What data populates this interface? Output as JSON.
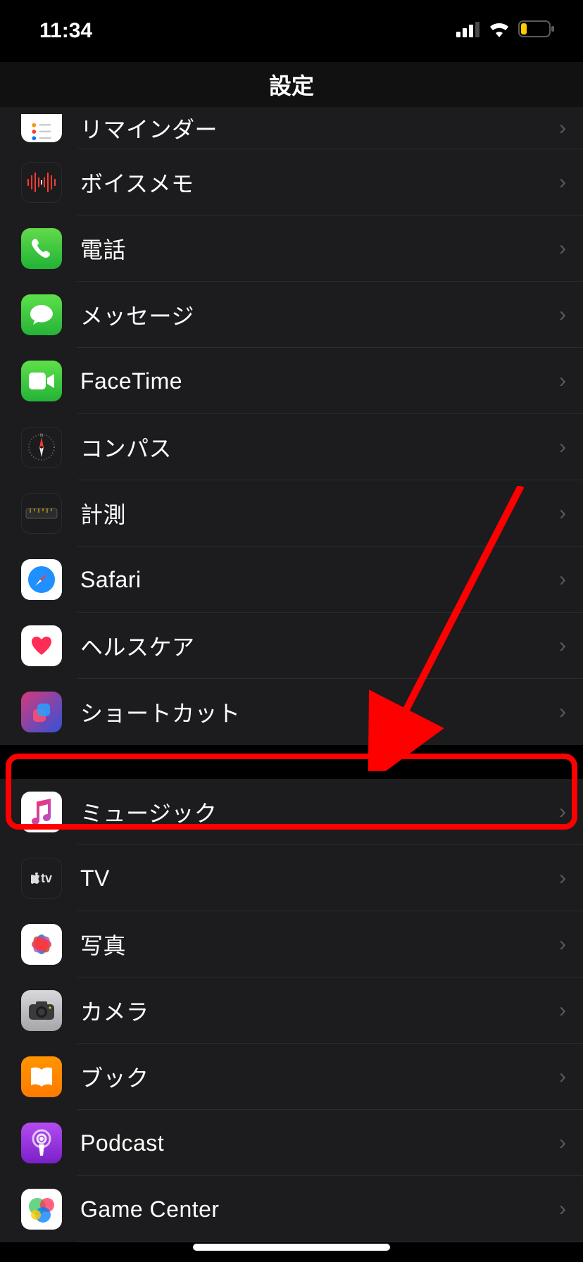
{
  "status": {
    "time": "11:34"
  },
  "nav": {
    "title": "設定"
  },
  "section1": [
    {
      "id": "reminders",
      "label": "リマインダー"
    },
    {
      "id": "voicememo",
      "label": "ボイスメモ"
    },
    {
      "id": "phone",
      "label": "電話"
    },
    {
      "id": "messages",
      "label": "メッセージ"
    },
    {
      "id": "facetime",
      "label": "FaceTime"
    },
    {
      "id": "compass",
      "label": "コンパス"
    },
    {
      "id": "measure",
      "label": "計測"
    },
    {
      "id": "safari",
      "label": "Safari"
    },
    {
      "id": "health",
      "label": "ヘルスケア"
    },
    {
      "id": "shortcuts",
      "label": "ショートカット"
    }
  ],
  "section2": [
    {
      "id": "music",
      "label": "ミュージック"
    },
    {
      "id": "tv",
      "label": "TV"
    },
    {
      "id": "photos",
      "label": "写真"
    },
    {
      "id": "camera",
      "label": "カメラ"
    },
    {
      "id": "books",
      "label": "ブック"
    },
    {
      "id": "podcast",
      "label": "Podcast"
    },
    {
      "id": "gamecenter",
      "label": "Game Center"
    }
  ],
  "tv_glyph": "tv",
  "annotation": {
    "type": "arrow+box",
    "target": "music"
  }
}
